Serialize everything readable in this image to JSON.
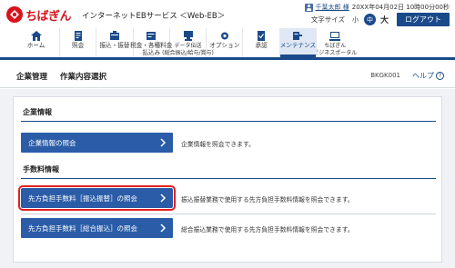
{
  "header": {
    "brand": "ちばぎん",
    "service": "インターネットEBサービス ＜Web-EB＞",
    "user": {
      "name": "千葉太郎 様",
      "login_time": "20XX年04月02日 10時00分00秒"
    },
    "font_size": {
      "label": "文字サイズ",
      "small": "小",
      "medium": "中",
      "large": "大",
      "selected": "medium"
    },
    "logout_label": "ログアウト"
  },
  "nav": {
    "items": [
      {
        "label": "ホーム",
        "icon": "home-icon"
      },
      {
        "label": "照会",
        "icon": "inquiry-icon"
      },
      {
        "label": "振込・振替",
        "icon": "transfer-icon"
      },
      {
        "label": "税金・各種料金\n払込み",
        "icon": "tax-payment-icon"
      },
      {
        "label": "データ伝送\n(総合振込/給与/賞与)",
        "icon": "data-transmission-icon"
      },
      {
        "label": "オプション",
        "icon": "option-icon"
      },
      {
        "label": "承認",
        "icon": "approval-icon"
      },
      {
        "label": "メンテナンス",
        "icon": "maintenance-icon"
      },
      {
        "label": "ちばぎん\nビジネスポータル",
        "icon": "portal-icon"
      }
    ],
    "active": "メンテナンス"
  },
  "title_bar": {
    "main": "企業管理",
    "sub": "作業内容選択",
    "screen_id": "BKGK001",
    "help_label": "ヘルプ"
  },
  "sections": [
    {
      "heading": "企業情報",
      "actions": [
        {
          "label": "企業情報の照会",
          "desc": "企業情報を照会できます。"
        }
      ]
    },
    {
      "heading": "手数料情報",
      "actions": [
        {
          "label": "先方負担手数料［振込振替］の照会",
          "desc": "振込振替業務で使用する先方負担手数料情報を照会できます。"
        },
        {
          "label": "先方負担手数料［総合振込］の照会",
          "desc": "総合振込業務で使用する先方負担手数料情報を照会できます。"
        }
      ]
    }
  ],
  "colors": {
    "brand_red": "#d7131c",
    "primary_blue": "#2a5ca8",
    "nav_blue": "#1a4a8a",
    "highlight_red": "#e02020"
  }
}
